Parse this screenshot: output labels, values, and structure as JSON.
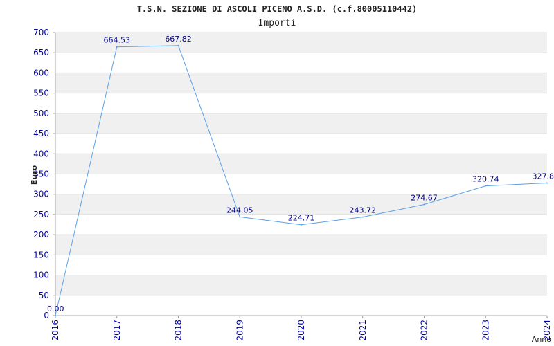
{
  "chart_data": {
    "type": "line",
    "title": "T.S.N. SEZIONE DI ASCOLI PICENO A.S.D. (c.f.80005110442)",
    "subtitle": "Importi",
    "xlabel": "Anno",
    "ylabel": "Euro",
    "ylim": [
      0,
      700
    ],
    "yticks": [
      0,
      50,
      100,
      150,
      200,
      250,
      300,
      350,
      400,
      450,
      500,
      550,
      600,
      650,
      700
    ],
    "categories": [
      "2016",
      "2017",
      "2018",
      "2019",
      "2020",
      "2021",
      "2022",
      "2023",
      "2024"
    ],
    "values": [
      0,
      664.53,
      667.82,
      244.05,
      224.71,
      243.72,
      274.67,
      320.74,
      327.8
    ],
    "data_labels": [
      "0.00",
      "664.53",
      "667.82",
      "244.05",
      "224.71",
      "243.72",
      "274.67",
      "320.74",
      "327.8"
    ],
    "grid": true,
    "colors": {
      "line": "#5aa0e6",
      "tick_text": "#0000aa",
      "band": "#f0f0f0",
      "gridline": "#dddddd"
    }
  }
}
